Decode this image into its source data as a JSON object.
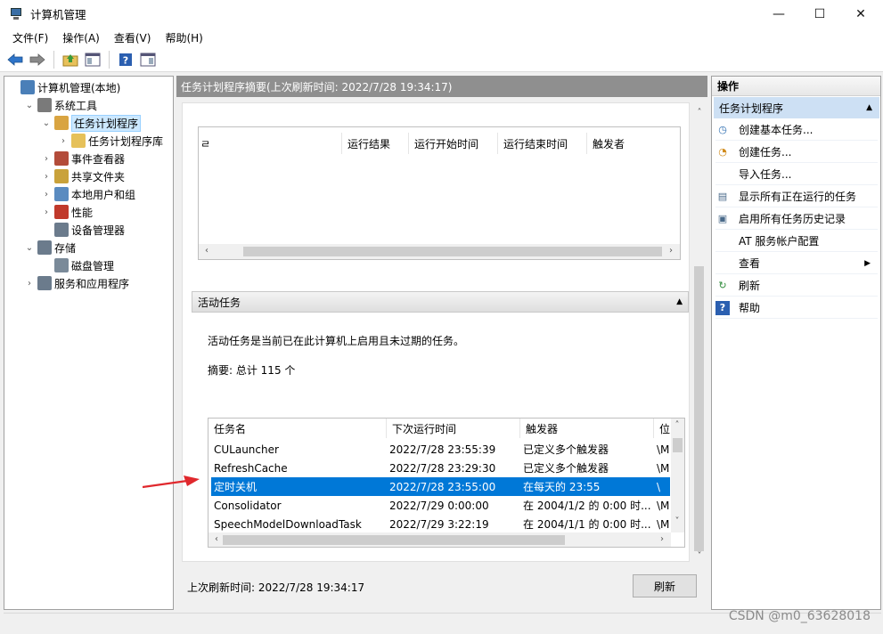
{
  "window": {
    "title": "计算机管理",
    "controls": {
      "minimize": "—",
      "maximize": "☐",
      "close": "✕"
    }
  },
  "menu": [
    "文件(F)",
    "操作(A)",
    "查看(V)",
    "帮助(H)"
  ],
  "toolbar": {
    "icons": [
      "back-arrow-icon",
      "forward-arrow-icon",
      "up-folder-icon",
      "properties-icon",
      "help-icon",
      "show-hide-icon"
    ]
  },
  "tree": {
    "items": [
      {
        "label": "计算机管理(本地)",
        "level": 0,
        "arrow": "",
        "icon": "computer-icon",
        "color": "#4a7fb8"
      },
      {
        "label": "系统工具",
        "level": 1,
        "arrow": "⌄",
        "icon": "tools-icon",
        "color": "#7a7a7a"
      },
      {
        "label": "任务计划程序",
        "level": 2,
        "arrow": "⌄",
        "icon": "clock-icon",
        "color": "#d9a441",
        "selected": true
      },
      {
        "label": "任务计划程序库",
        "level": 3,
        "arrow": "›",
        "icon": "folder-clock-icon",
        "color": "#e6c15a"
      },
      {
        "label": "事件查看器",
        "level": 2,
        "arrow": "›",
        "icon": "event-viewer-icon",
        "color": "#b34c3a"
      },
      {
        "label": "共享文件夹",
        "level": 2,
        "arrow": "›",
        "icon": "shared-folder-icon",
        "color": "#c9a23b"
      },
      {
        "label": "本地用户和组",
        "level": 2,
        "arrow": "›",
        "icon": "users-icon",
        "color": "#5a8bc0"
      },
      {
        "label": "性能",
        "level": 2,
        "arrow": "›",
        "icon": "performance-icon",
        "color": "#c0392b"
      },
      {
        "label": "设备管理器",
        "level": 2,
        "arrow": "",
        "icon": "device-manager-icon",
        "color": "#6b7b8c"
      },
      {
        "label": "存储",
        "level": 1,
        "arrow": "⌄",
        "icon": "storage-icon",
        "color": "#6b7b8c"
      },
      {
        "label": "磁盘管理",
        "level": 2,
        "arrow": "",
        "icon": "disk-icon",
        "color": "#7a8a99"
      },
      {
        "label": "服务和应用程序",
        "level": 1,
        "arrow": "›",
        "icon": "services-icon",
        "color": "#6b7b8c"
      }
    ]
  },
  "middle": {
    "header": "任务计划程序摘要(上次刷新时间: 2022/7/28 19:34:17)",
    "upper_columns": [
      "运行结果",
      "运行开始时间",
      "运行结束时间",
      "触发者"
    ],
    "upper_first_fragment": "ㄹ",
    "section_title": "活动任务",
    "description": "活动任务是当前已在此计算机上启用且未过期的任务。",
    "summary": "摘要: 总计 115 个",
    "task_columns": [
      "任务名",
      "下次运行时间",
      "触发器",
      "位"
    ],
    "tasks": [
      {
        "name": "CULauncher",
        "next": "2022/7/28 23:55:39",
        "trigger": "已定义多个触发器",
        "loc": "\\M"
      },
      {
        "name": "RefreshCache",
        "next": "2022/7/28 23:29:30",
        "trigger": "已定义多个触发器",
        "loc": "\\M"
      },
      {
        "name": "定时关机",
        "next": "2022/7/28 23:55:00",
        "trigger": "在每天的 23:55",
        "loc": "\\",
        "selected": true
      },
      {
        "name": "Consolidator",
        "next": "2022/7/29 0:00:00",
        "trigger": "在 2004/1/2 的 0:00 时...",
        "loc": "\\M"
      },
      {
        "name": "SpeechModelDownloadTask",
        "next": "2022/7/29 3:22:19",
        "trigger": "在 2004/1/1 的 0:00 时...",
        "loc": "\\M"
      }
    ],
    "last_refresh": "上次刷新时间: 2022/7/28 19:34:17",
    "refresh_button": "刷新"
  },
  "actions": {
    "header": "操作",
    "group": "任务计划程序",
    "items": [
      {
        "label": "创建基本任务...",
        "icon": "create-basic-task-icon",
        "glyph": "◷",
        "color": "#2b6cb0"
      },
      {
        "label": "创建任务...",
        "icon": "create-task-icon",
        "glyph": "◔",
        "color": "#d08a1a"
      },
      {
        "label": "导入任务...",
        "icon": "",
        "glyph": "",
        "color": "#000000"
      },
      {
        "label": "显示所有正在运行的任务",
        "icon": "running-tasks-icon",
        "glyph": "▤",
        "color": "#4a6a8a"
      },
      {
        "label": "启用所有任务历史记录",
        "icon": "history-icon",
        "glyph": "▣",
        "color": "#4a6a8a"
      },
      {
        "label": "AT 服务帐户配置",
        "icon": "",
        "glyph": "",
        "color": "#000000"
      },
      {
        "label": "查看",
        "icon": "",
        "glyph": "",
        "color": "#000000",
        "submenu": true
      },
      {
        "label": "刷新",
        "icon": "refresh-icon",
        "glyph": "↻",
        "color": "#2e8b3a"
      },
      {
        "label": "帮助",
        "icon": "help-icon",
        "glyph": "?",
        "color": "#ffffff",
        "bg": "#2b5fb0"
      }
    ]
  },
  "watermark": "CSDN @m0_63628018",
  "colors": {
    "selection": "#0078d7",
    "tree_selection": "#cce8ff",
    "arrow": "#e0282d"
  }
}
